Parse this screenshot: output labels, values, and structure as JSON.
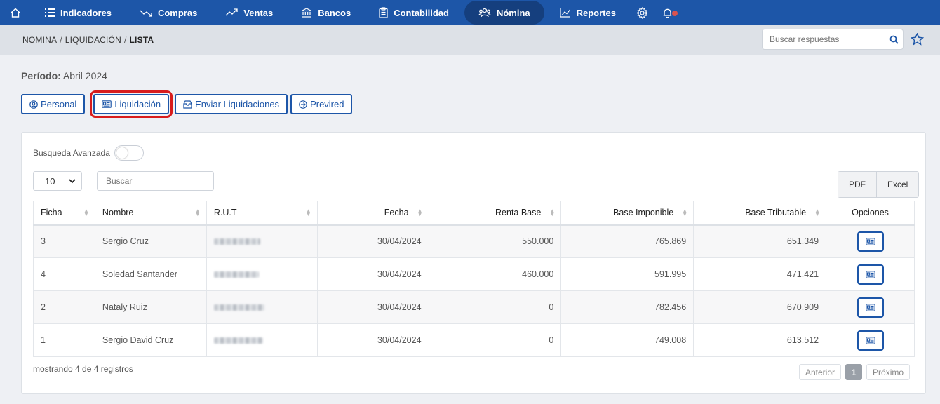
{
  "nav": {
    "items": [
      {
        "label": "Indicadores",
        "icon": "list-icon"
      },
      {
        "label": "Compras",
        "icon": "trend-down-icon"
      },
      {
        "label": "Ventas",
        "icon": "trend-up-icon"
      },
      {
        "label": "Bancos",
        "icon": "bank-icon"
      },
      {
        "label": "Contabilidad",
        "icon": "clipboard-icon"
      },
      {
        "label": "Nómina",
        "icon": "users-icon"
      },
      {
        "label": "Reportes",
        "icon": "chart-icon"
      }
    ],
    "active": "Nómina",
    "accent_color": "#1d56a8"
  },
  "breadcrumb": {
    "items": [
      "NOMINA",
      "LIQUIDACIÓN"
    ],
    "current": "LISTA",
    "separator": "/"
  },
  "search": {
    "placeholder": "Buscar respuestas"
  },
  "period": {
    "label": "Período:",
    "value": "Abril 2024"
  },
  "action_buttons": [
    {
      "label": "Personal",
      "icon": "user-circle-icon"
    },
    {
      "label": "Liquidación",
      "icon": "id-card-icon",
      "highlighted": true
    },
    {
      "label": "Enviar Liquidaciones",
      "icon": "inbox-icon"
    },
    {
      "label": "Previred",
      "icon": "arrow-circle-icon"
    }
  ],
  "table_controls": {
    "advanced_search_label": "Busqueda Avanzada",
    "advanced_search_on": false,
    "page_length": "10",
    "filter_placeholder": "Buscar",
    "export_buttons": [
      "PDF",
      "Excel"
    ]
  },
  "table": {
    "columns": [
      "Ficha",
      "Nombre",
      "R.U.T",
      "Fecha",
      "Renta Base",
      "Base Imponible",
      "Base Tributable",
      "Opciones"
    ],
    "rows": [
      {
        "ficha": "3",
        "nombre": "Sergio Cruz",
        "rut": "",
        "fecha": "30/04/2024",
        "renta_base": "550.000",
        "base_imponible": "765.869",
        "base_tributable": "651.349"
      },
      {
        "ficha": "4",
        "nombre": "Soledad Santander",
        "rut": "",
        "fecha": "30/04/2024",
        "renta_base": "460.000",
        "base_imponible": "591.995",
        "base_tributable": "471.421"
      },
      {
        "ficha": "2",
        "nombre": "Nataly Ruiz",
        "rut": "",
        "fecha": "30/04/2024",
        "renta_base": "0",
        "base_imponible": "782.456",
        "base_tributable": "670.909"
      },
      {
        "ficha": "1",
        "nombre": "Sergio David Cruz",
        "rut": "",
        "fecha": "30/04/2024",
        "renta_base": "0",
        "base_imponible": "749.008",
        "base_tributable": "613.512"
      }
    ]
  },
  "footer": {
    "info": "mostrando 4 de 4 registros",
    "prev": "Anterior",
    "current_page": "1",
    "next": "Próximo"
  }
}
